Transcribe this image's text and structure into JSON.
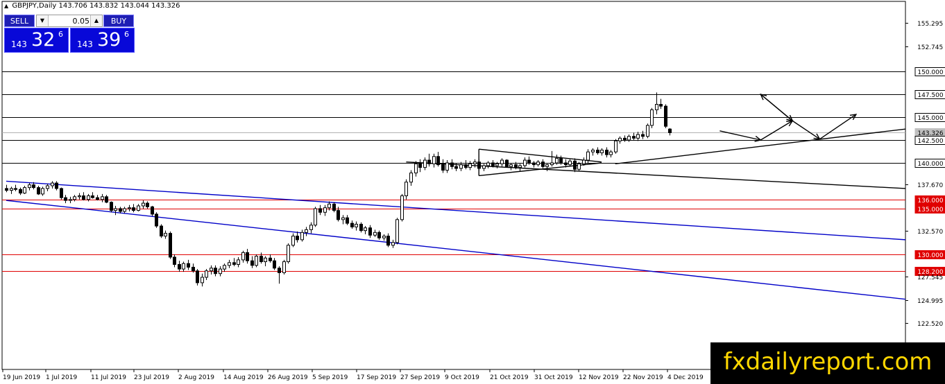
{
  "header": {
    "symbol_tf": "GBPJPY,Daily",
    "ohlc": "143.706 143.832 143.044 143.326"
  },
  "trade_panel": {
    "sell_label": "SELL",
    "buy_label": "BUY",
    "lot_value": "0.05",
    "sell_quote": {
      "prefix": "143",
      "big": "32",
      "sup": "6"
    },
    "buy_quote": {
      "prefix": "143",
      "big": "39",
      "sup": "6"
    }
  },
  "watermark": "fxdailyreport.com",
  "colors": {
    "blue_trend": "#0000c8",
    "red_level": "#e00000",
    "bull_body": "#ffffff",
    "bear_body": "#000000",
    "current_price_bg": "#c0c0c0"
  },
  "chart_data": {
    "type": "candlestick",
    "symbol": "GBPJPY",
    "timeframe": "Daily",
    "ylim": [
      113.0,
      156.6
    ],
    "y_axis_ticks": [
      "155.295",
      "152.745",
      "137.670",
      "132.570",
      "127.545",
      "124.995",
      "122.520"
    ],
    "x_axis_labels": [
      "19 Jun 2019",
      "1 Jul 2019",
      "11 Jul 2019",
      "23 Jul 2019",
      "2 Aug 2019",
      "14 Aug 2019",
      "26 Aug 2019",
      "5 Sep 2019",
      "17 Sep 2019",
      "27 Sep 2019",
      "9 Oct 2019",
      "21 Oct 2019",
      "31 Oct 2019",
      "12 Nov 2019",
      "22 Nov 2019",
      "4 Dec 2019"
    ],
    "horizontal_levels": [
      {
        "value": "150.000",
        "color": "black"
      },
      {
        "value": "147.500",
        "color": "black"
      },
      {
        "value": "145.000",
        "color": "black"
      },
      {
        "value": "143.326",
        "color": "current"
      },
      {
        "value": "142.500",
        "color": "black"
      },
      {
        "value": "140.000",
        "color": "black"
      },
      {
        "value": "136.000",
        "color": "red"
      },
      {
        "value": "135.000",
        "color": "red"
      },
      {
        "value": "130.000",
        "color": "red"
      },
      {
        "value": "128.200",
        "color": "red"
      }
    ],
    "trendlines": [
      {
        "color": "blue",
        "from": {
          "bar": 0,
          "price": 138.0
        },
        "to": {
          "bar": 203,
          "price": 131.6
        }
      },
      {
        "color": "blue",
        "from": {
          "bar": 0,
          "price": 135.9
        },
        "to": {
          "bar": 203,
          "price": 125.1
        }
      },
      {
        "color": "black",
        "from": {
          "bar": 88,
          "price": 140.1
        },
        "to": {
          "bar": 203,
          "price": 137.2
        }
      },
      {
        "color": "black",
        "from": {
          "bar": 134,
          "price": 139.9
        },
        "to": {
          "bar": 203,
          "price": 143.7
        }
      }
    ],
    "triangle": {
      "top_from": [
        104,
        141.5
      ],
      "top_to": [
        131,
        140.1
      ],
      "bottom_from": [
        104,
        138.6
      ],
      "bottom_to": [
        131,
        140.0
      ]
    },
    "projection_path": [
      [
        157,
        143.5
      ],
      [
        166,
        142.5
      ],
      [
        173,
        144.6
      ],
      [
        166,
        147.5
      ],
      [
        173,
        144.6
      ],
      [
        179,
        142.6
      ],
      [
        187,
        145.3
      ]
    ],
    "candles": [
      [
        137.2,
        137.6,
        136.8,
        137.0
      ],
      [
        137.0,
        137.4,
        136.6,
        137.2
      ],
      [
        137.2,
        137.6,
        136.9,
        137.1
      ],
      [
        137.1,
        137.3,
        136.5,
        136.7
      ],
      [
        136.7,
        137.5,
        136.6,
        137.3
      ],
      [
        137.3,
        137.8,
        137.0,
        137.6
      ],
      [
        137.6,
        137.9,
        137.1,
        137.3
      ],
      [
        137.3,
        137.5,
        136.5,
        136.6
      ],
      [
        136.6,
        137.4,
        136.4,
        137.2
      ],
      [
        137.2,
        137.7,
        136.9,
        137.5
      ],
      [
        137.5,
        138.0,
        137.2,
        137.8
      ],
      [
        137.8,
        138.0,
        137.0,
        137.2
      ],
      [
        137.2,
        137.3,
        136.0,
        136.2
      ],
      [
        136.2,
        136.5,
        135.6,
        135.9
      ],
      [
        135.9,
        136.3,
        135.6,
        136.0
      ],
      [
        136.0,
        136.5,
        135.8,
        136.3
      ],
      [
        136.3,
        136.7,
        136.0,
        136.4
      ],
      [
        136.4,
        136.8,
        135.9,
        136.0
      ],
      [
        136.0,
        136.6,
        135.8,
        136.4
      ],
      [
        136.4,
        136.8,
        136.1,
        136.2
      ],
      [
        136.2,
        136.5,
        135.9,
        136.0
      ],
      [
        136.0,
        136.6,
        135.7,
        136.3
      ],
      [
        136.3,
        136.5,
        135.6,
        135.7
      ],
      [
        135.7,
        135.8,
        134.6,
        134.8
      ],
      [
        134.8,
        135.3,
        134.3,
        135.0
      ],
      [
        135.0,
        135.2,
        134.5,
        134.7
      ],
      [
        134.7,
        135.2,
        134.5,
        135.0
      ],
      [
        135.0,
        135.4,
        134.7,
        135.1
      ],
      [
        135.1,
        135.5,
        134.6,
        134.8
      ],
      [
        134.8,
        135.5,
        134.7,
        135.3
      ],
      [
        135.3,
        135.9,
        135.0,
        135.6
      ],
      [
        135.6,
        135.8,
        135.0,
        135.2
      ],
      [
        135.2,
        135.3,
        134.2,
        134.4
      ],
      [
        134.4,
        134.6,
        132.9,
        133.1
      ],
      [
        133.1,
        133.3,
        131.8,
        132.0
      ],
      [
        132.0,
        132.6,
        131.7,
        132.3
      ],
      [
        132.3,
        132.5,
        129.5,
        129.7
      ],
      [
        129.7,
        130.0,
        128.6,
        128.9
      ],
      [
        128.9,
        129.3,
        128.1,
        128.4
      ],
      [
        128.4,
        129.2,
        128.1,
        129.0
      ],
      [
        129.0,
        129.4,
        128.3,
        128.6
      ],
      [
        128.6,
        129.0,
        128.0,
        128.2
      ],
      [
        128.2,
        128.4,
        126.6,
        126.9
      ],
      [
        126.9,
        127.9,
        126.5,
        127.5
      ],
      [
        127.5,
        128.4,
        127.2,
        128.2
      ],
      [
        128.2,
        128.8,
        127.8,
        128.5
      ],
      [
        128.5,
        128.8,
        127.6,
        127.9
      ],
      [
        127.9,
        128.7,
        127.6,
        128.4
      ],
      [
        128.4,
        129.0,
        128.1,
        128.8
      ],
      [
        128.8,
        129.4,
        128.5,
        129.1
      ],
      [
        129.1,
        129.6,
        128.7,
        128.9
      ],
      [
        128.9,
        129.7,
        128.6,
        129.4
      ],
      [
        129.4,
        130.4,
        129.1,
        130.2
      ],
      [
        130.2,
        130.6,
        129.0,
        129.3
      ],
      [
        129.3,
        129.8,
        128.5,
        128.8
      ],
      [
        128.8,
        130.0,
        128.6,
        129.8
      ],
      [
        129.8,
        130.2,
        129.0,
        129.2
      ],
      [
        129.2,
        129.8,
        128.7,
        129.6
      ],
      [
        129.6,
        130.0,
        129.1,
        129.3
      ],
      [
        129.3,
        129.6,
        128.3,
        128.5
      ],
      [
        128.5,
        128.7,
        126.8,
        128.0
      ],
      [
        128.0,
        129.4,
        127.8,
        129.2
      ],
      [
        129.2,
        131.2,
        129.0,
        131.0
      ],
      [
        131.0,
        132.3,
        130.8,
        132.0
      ],
      [
        132.0,
        132.5,
        131.3,
        131.6
      ],
      [
        131.6,
        132.7,
        131.4,
        132.4
      ],
      [
        132.4,
        133.0,
        132.0,
        132.7
      ],
      [
        132.7,
        133.5,
        132.3,
        133.2
      ],
      [
        133.2,
        135.2,
        133.0,
        135.0
      ],
      [
        135.0,
        135.4,
        134.3,
        134.6
      ],
      [
        134.6,
        135.4,
        134.2,
        135.1
      ],
      [
        135.1,
        135.8,
        134.8,
        135.5
      ],
      [
        135.5,
        135.7,
        134.6,
        134.8
      ],
      [
        134.8,
        135.2,
        133.6,
        133.8
      ],
      [
        133.8,
        134.3,
        133.3,
        134.0
      ],
      [
        134.0,
        134.3,
        133.2,
        133.4
      ],
      [
        133.4,
        133.7,
        132.8,
        133.0
      ],
      [
        133.0,
        133.6,
        132.6,
        133.3
      ],
      [
        133.3,
        133.5,
        132.4,
        132.6
      ],
      [
        132.6,
        133.1,
        132.2,
        132.9
      ],
      [
        132.9,
        133.2,
        131.8,
        132.1
      ],
      [
        132.1,
        132.7,
        131.9,
        132.4
      ],
      [
        132.4,
        132.6,
        131.6,
        131.8
      ],
      [
        131.8,
        132.2,
        131.5,
        132.0
      ],
      [
        132.0,
        132.3,
        130.8,
        131.0
      ],
      [
        131.0,
        131.6,
        130.7,
        131.3
      ],
      [
        131.3,
        134.0,
        131.1,
        133.8
      ],
      [
        133.8,
        136.6,
        133.6,
        136.4
      ],
      [
        136.4,
        138.2,
        136.0,
        137.9
      ],
      [
        137.9,
        139.2,
        137.5,
        138.9
      ],
      [
        138.9,
        140.2,
        138.5,
        139.9
      ],
      [
        139.9,
        140.4,
        139.0,
        139.5
      ],
      [
        139.5,
        140.6,
        139.2,
        140.3
      ],
      [
        140.3,
        141.0,
        139.6,
        139.9
      ],
      [
        139.9,
        141.0,
        139.5,
        140.7
      ],
      [
        140.7,
        141.2,
        139.6,
        139.8
      ],
      [
        139.8,
        140.4,
        138.9,
        139.2
      ],
      [
        139.2,
        140.3,
        138.9,
        140.0
      ],
      [
        140.0,
        140.4,
        139.3,
        139.6
      ],
      [
        139.6,
        140.0,
        139.1,
        139.4
      ],
      [
        139.4,
        140.1,
        139.1,
        139.8
      ],
      [
        139.8,
        140.3,
        139.3,
        139.5
      ],
      [
        139.5,
        140.2,
        139.2,
        139.9
      ],
      [
        139.9,
        140.4,
        139.5,
        140.1
      ],
      [
        140.1,
        140.4,
        139.2,
        139.4
      ],
      [
        139.4,
        139.9,
        139.1,
        139.7
      ],
      [
        139.7,
        140.2,
        139.4,
        140.0
      ],
      [
        140.0,
        140.3,
        139.5,
        139.7
      ],
      [
        139.7,
        140.1,
        139.4,
        139.9
      ],
      [
        139.9,
        140.5,
        139.6,
        140.3
      ],
      [
        140.3,
        140.4,
        139.5,
        139.6
      ],
      [
        139.6,
        140.0,
        139.2,
        139.8
      ],
      [
        139.8,
        140.1,
        139.3,
        139.5
      ],
      [
        139.5,
        139.9,
        139.1,
        139.7
      ],
      [
        139.7,
        140.6,
        139.5,
        140.3
      ],
      [
        140.3,
        140.7,
        139.8,
        140.0
      ],
      [
        140.0,
        140.2,
        139.5,
        139.8
      ],
      [
        139.8,
        140.3,
        139.6,
        140.1
      ],
      [
        140.1,
        140.4,
        139.4,
        139.6
      ],
      [
        139.6,
        139.9,
        139.1,
        139.8
      ],
      [
        139.8,
        141.3,
        139.6,
        140.0
      ],
      [
        140.0,
        140.9,
        139.8,
        140.5
      ],
      [
        140.5,
        140.8,
        139.8,
        140.0
      ],
      [
        140.0,
        140.4,
        139.5,
        139.8
      ],
      [
        139.8,
        140.4,
        139.6,
        140.2
      ],
      [
        140.2,
        140.5,
        139.0,
        139.3
      ],
      [
        139.3,
        140.1,
        139.1,
        139.9
      ],
      [
        139.9,
        140.6,
        139.7,
        140.3
      ],
      [
        140.3,
        141.5,
        140.0,
        141.2
      ],
      [
        141.2,
        141.6,
        140.8,
        141.4
      ],
      [
        141.4,
        141.7,
        140.9,
        141.1
      ],
      [
        141.1,
        141.6,
        140.8,
        141.4
      ],
      [
        141.4,
        141.7,
        140.6,
        140.9
      ],
      [
        140.9,
        141.4,
        140.6,
        141.2
      ],
      [
        141.2,
        142.6,
        141.0,
        142.4
      ],
      [
        142.4,
        142.9,
        142.1,
        142.7
      ],
      [
        142.7,
        143.0,
        142.3,
        142.5
      ],
      [
        142.5,
        143.1,
        142.3,
        142.9
      ],
      [
        142.9,
        143.3,
        142.5,
        142.7
      ],
      [
        142.7,
        143.4,
        142.4,
        143.1
      ],
      [
        143.1,
        143.5,
        142.6,
        142.9
      ],
      [
        142.9,
        144.3,
        142.7,
        144.1
      ],
      [
        144.1,
        146.0,
        143.8,
        145.8
      ],
      [
        145.8,
        147.7,
        145.3,
        146.4
      ],
      [
        146.4,
        147.0,
        145.9,
        146.2
      ],
      [
        146.2,
        146.4,
        143.8,
        144.0
      ],
      [
        143.7,
        143.8,
        143.0,
        143.3
      ]
    ]
  }
}
